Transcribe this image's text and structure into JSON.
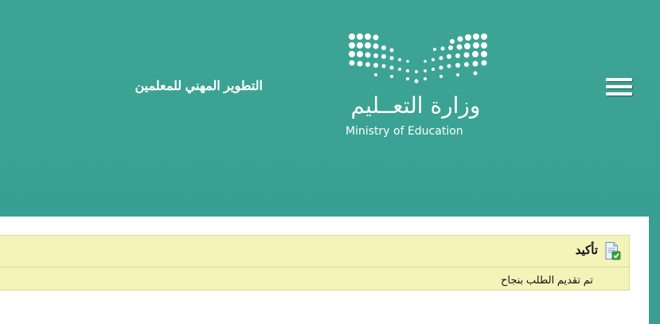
{
  "header": {
    "site_title": "التطوير المهني للمعلمين",
    "logo": {
      "arabic_name": "وزارة التعــليم",
      "english_name": "Ministry of Education"
    },
    "menu_icon": "hamburger-menu-icon"
  },
  "alert": {
    "title": "تأكيد",
    "message": "تم تقديم الطلب بنجاح",
    "icon": "document-check-icon"
  },
  "colors": {
    "header_bg": "#3ba293",
    "alert_bg": "#f4f3b8",
    "alert_border": "#dedc9c",
    "text": "#111111"
  }
}
